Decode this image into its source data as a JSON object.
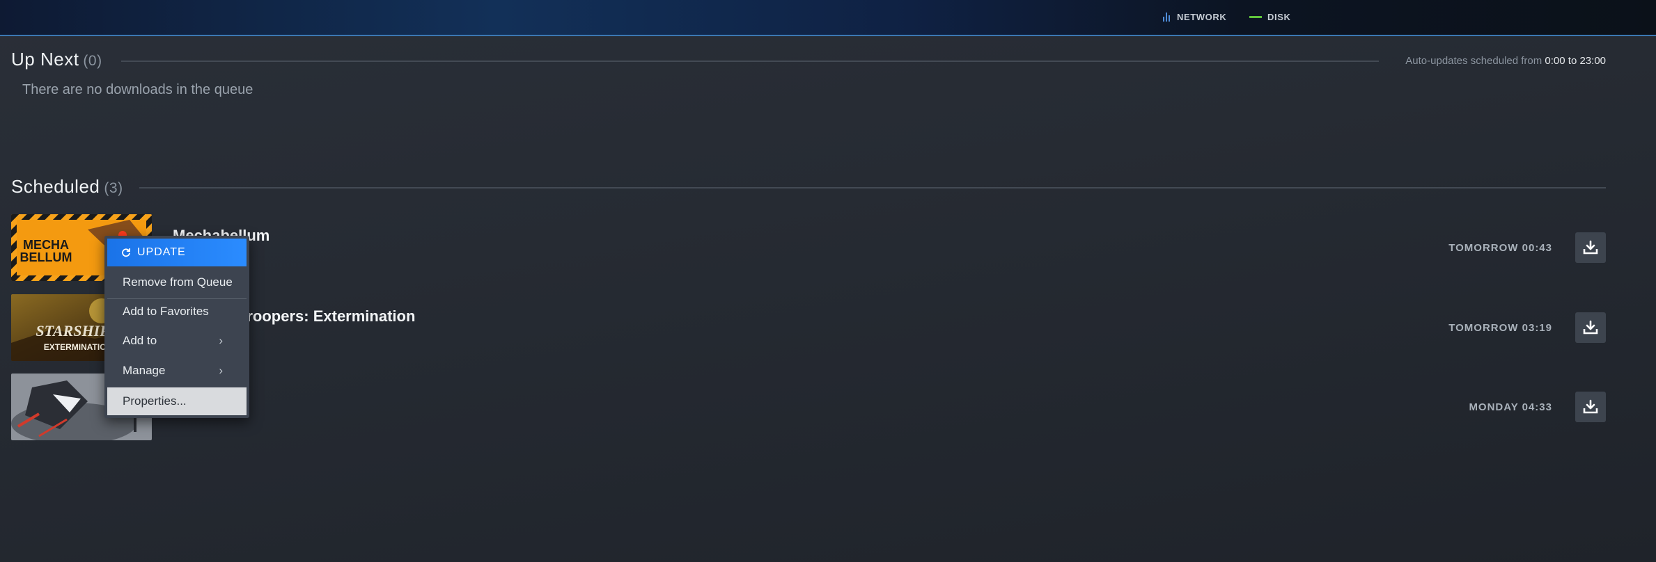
{
  "topbar": {
    "network_label": "NETWORK",
    "disk_label": "DISK",
    "colors": {
      "network": "#4f8cd8",
      "disk": "#5fc33b"
    }
  },
  "up_next": {
    "title": "Up Next",
    "count": "(0)",
    "empty_message": "There are no downloads in the queue",
    "auto_updates_prefix": "Auto-updates scheduled from",
    "auto_updates_range": "0:00 to 23:00"
  },
  "scheduled": {
    "title": "Scheduled",
    "count": "(3)",
    "items": [
      {
        "name": "Mechabellum",
        "time": "TOMORROW 00:43",
        "art_text": "MECHA BELLUM"
      },
      {
        "name": "Starship Troopers: Extermination",
        "time": "TOMORROW 03:19",
        "art_text": "STARSHIP TROOPERS EXTERMINATION"
      },
      {
        "name": "",
        "time": "MONDAY 04:33",
        "art_text": ""
      }
    ]
  },
  "context_menu": {
    "update": "UPDATE",
    "remove": "Remove from Queue",
    "favorites": "Add to Favorites",
    "add_to": "Add to",
    "manage": "Manage",
    "properties": "Properties...",
    "chevron": "›"
  },
  "icons": {
    "network": "bar-chart-icon",
    "disk": "line-icon",
    "download": "download-icon",
    "update": "refresh-icon",
    "submenu": "chevron-right-icon"
  },
  "accent_color": "#1a73e8"
}
